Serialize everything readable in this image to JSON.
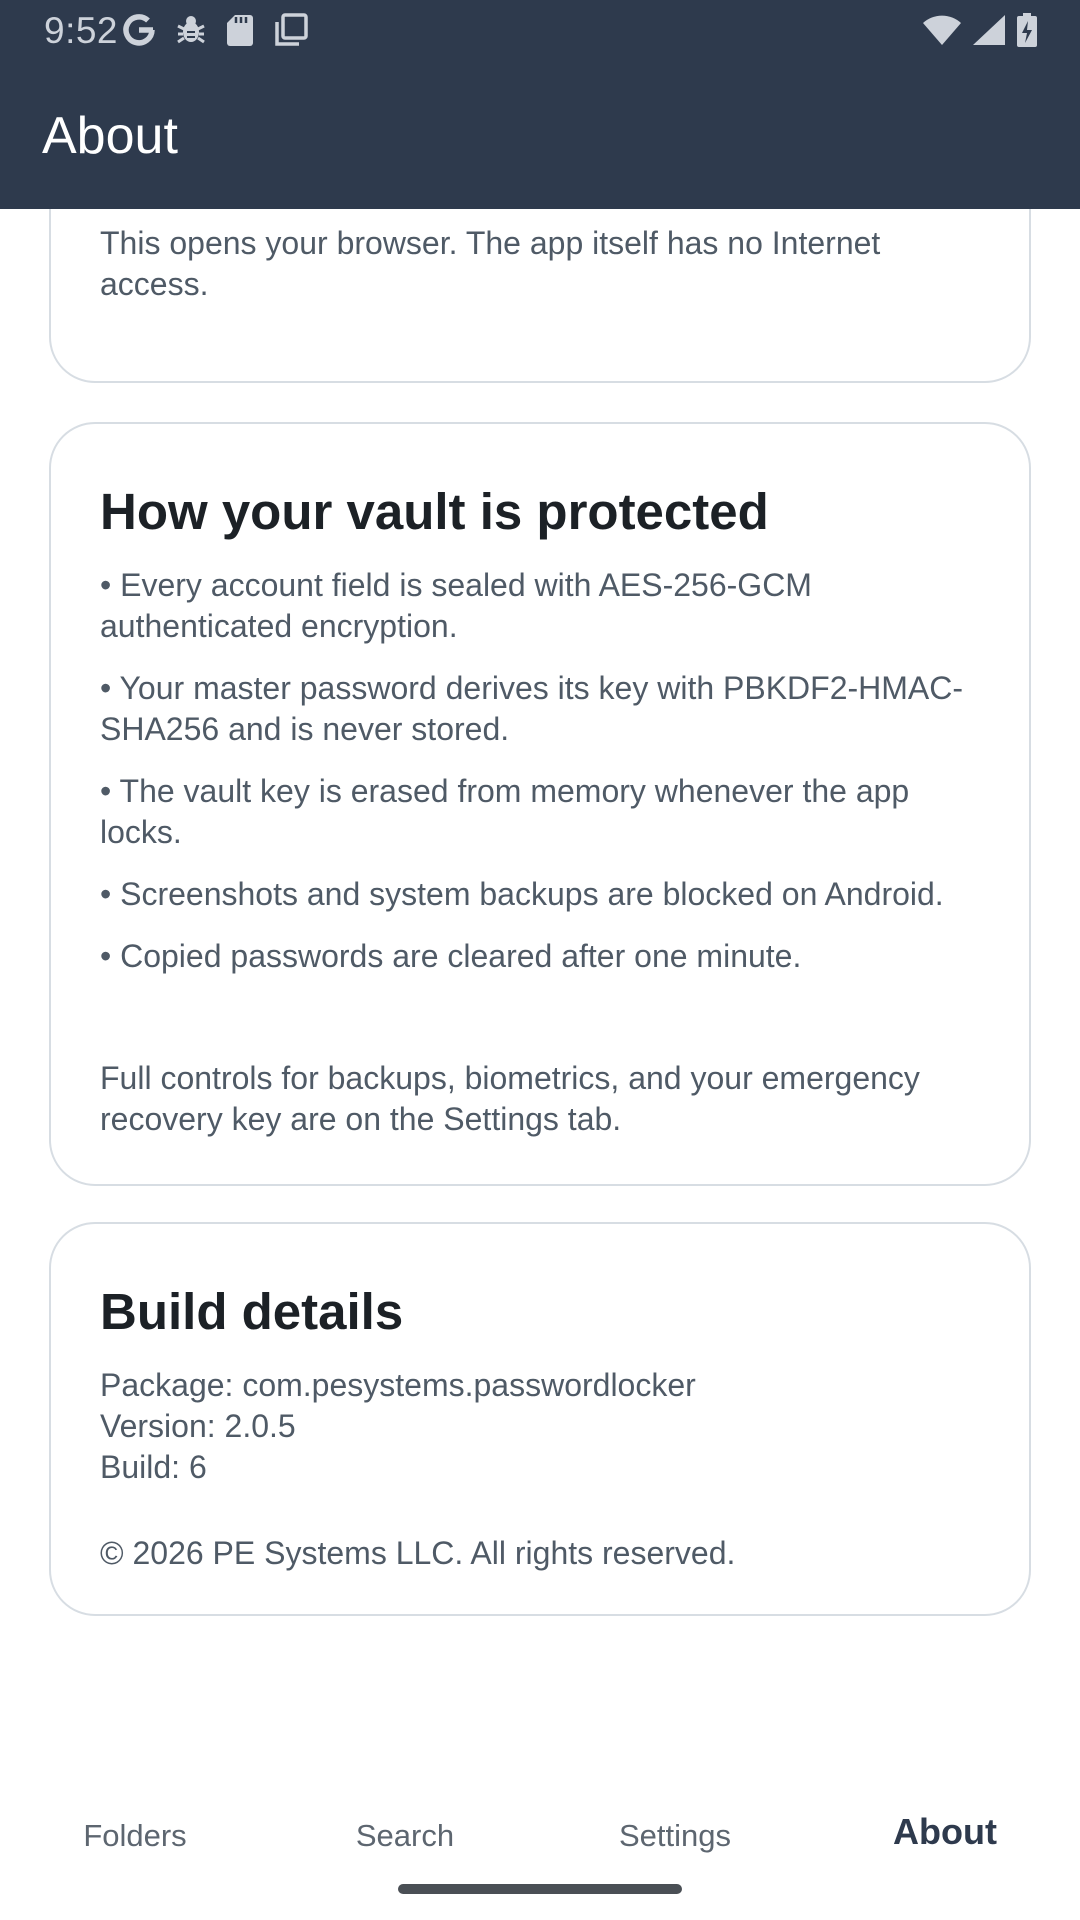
{
  "status_bar": {
    "time": "9:52",
    "icons_left": [
      "google-icon",
      "bug-icon",
      "sd-card-icon",
      "copy-icon"
    ],
    "icons_right": [
      "wifi-icon",
      "signal-icon",
      "battery-charging-icon"
    ]
  },
  "app_bar": {
    "title": "About"
  },
  "cards": {
    "browser_note": {
      "text": "This opens your browser. The app itself has no Internet access."
    },
    "protection": {
      "title": "How your vault is protected",
      "bullets": [
        "• Every account field is sealed with AES-256-GCM authenticated encryption.",
        "• Your master password derives its key with PBKDF2-HMAC-SHA256 and is never stored.",
        "• The vault key is erased from memory whenever the app locks.",
        "• Screenshots and system backups are blocked on Android.",
        "• Copied passwords are cleared after one minute."
      ],
      "note": "Full controls for backups, biometrics, and your emergency recovery key are on the Settings tab."
    },
    "build": {
      "title": "Build details",
      "package": "Package: com.pesystems.passwordlocker",
      "version": "Version: 2.0.5",
      "build": "Build: 6",
      "copyright": "© 2026 PE Systems LLC. All rights reserved."
    }
  },
  "bottom_nav": {
    "items": [
      "Folders",
      "Search",
      "Settings",
      "About"
    ],
    "active": "About"
  },
  "colors": {
    "app_bar": "#2e3a4d",
    "card_border": "#d7dde3",
    "accent_strip": "#e4f3ee",
    "body_text": "#4f5a66",
    "title_text": "#1c2126"
  }
}
